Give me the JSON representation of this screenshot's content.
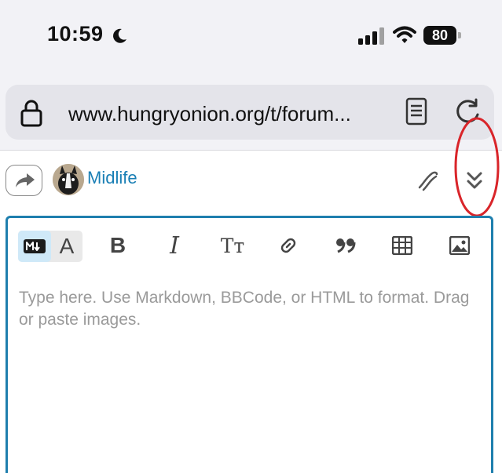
{
  "status": {
    "time": "10:59",
    "battery": "80",
    "icons": [
      "moon-icon",
      "signal-icon",
      "wifi-icon",
      "battery-icon"
    ]
  },
  "browser": {
    "url": "www.hungryonion.org/t/forum...",
    "icons": [
      "lock-icon",
      "reader-mode-icon",
      "reload-icon"
    ]
  },
  "composer": {
    "username": "Midlife",
    "reply_icon": "reply-arrow-icon",
    "whisper_icon": "whisper-icon",
    "collapse_icon": "double-chevron-down-icon",
    "annotation_color": "#d9252a",
    "toolbar": {
      "markdown_toggle": "M↓",
      "rich_text_toggle": "A",
      "bold": "B",
      "italic": "I",
      "heading": "Tт",
      "tools": [
        "markdown-icon",
        "rich-text-icon",
        "bold-icon",
        "italic-icon",
        "heading-icon",
        "link-icon",
        "quote-icon",
        "table-icon",
        "image-icon"
      ]
    },
    "placeholder": "Type here. Use Markdown, BBCode, or HTML to format. Drag or paste images."
  },
  "colors": {
    "accent": "#1e7fae",
    "username": "#1a7fb5",
    "placeholder": "#9a9a9a"
  }
}
